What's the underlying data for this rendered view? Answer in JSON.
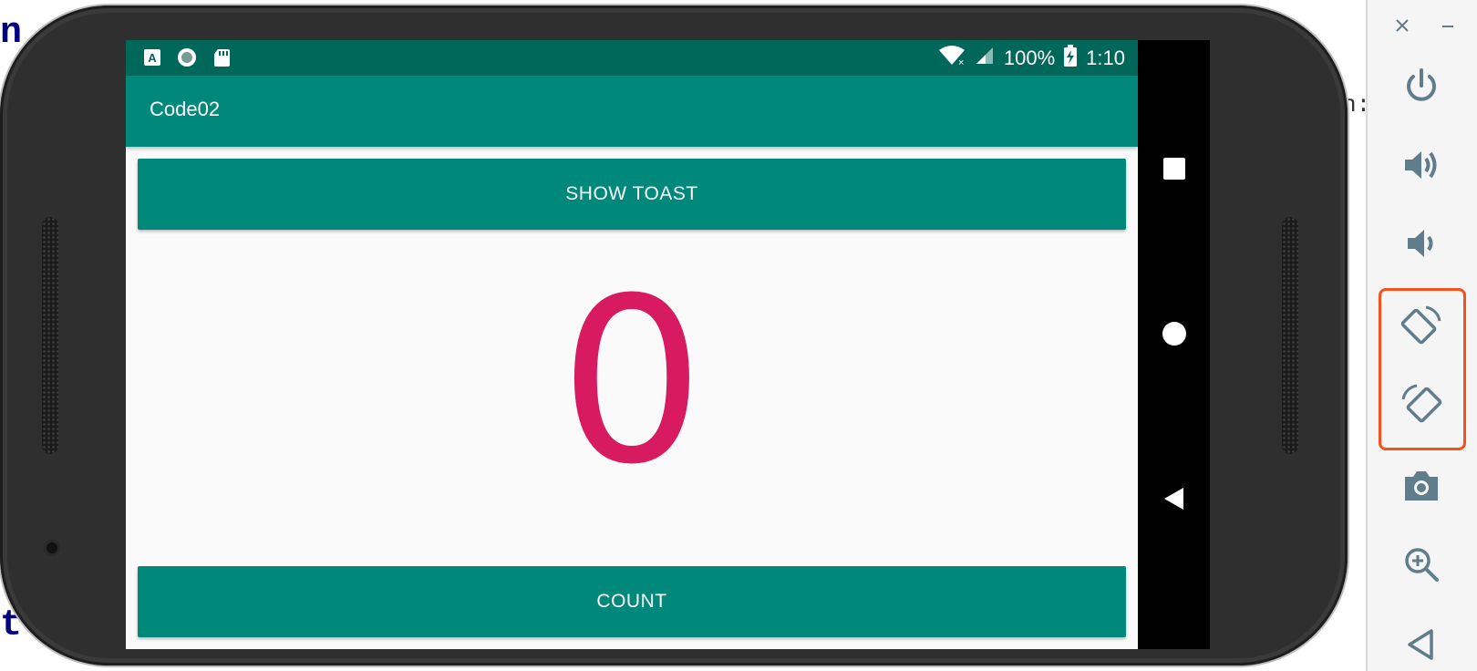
{
  "background": {
    "fragment_left_top": "n",
    "fragment_left_bottom": "t",
    "fragment_right": "n:"
  },
  "status_bar": {
    "battery": "100%",
    "time": "1:10",
    "icons": [
      "a-notification-icon",
      "record-icon",
      "sd-card-icon",
      "wifi-no-connection-icon",
      "signal-icon",
      "battery-charging-icon"
    ]
  },
  "app_bar": {
    "title": "Code02"
  },
  "buttons": {
    "show_toast": "SHOW TOAST",
    "count": "COUNT"
  },
  "counter": {
    "value": "0"
  },
  "nav_bar": {
    "icons": [
      "recents-icon",
      "home-icon",
      "back-icon"
    ]
  },
  "emulator_toolbar": {
    "window_controls": [
      "close-icon",
      "minimize-icon"
    ],
    "items": [
      "power-icon",
      "volume-up-icon",
      "volume-down-icon",
      "rotate-left-icon",
      "rotate-right-icon",
      "camera-icon",
      "zoom-icon",
      "back-icon"
    ]
  },
  "colors": {
    "primary": "#00897b",
    "primary_dark": "#00675b",
    "accent": "#d81b60",
    "highlight": "#f4511e"
  }
}
